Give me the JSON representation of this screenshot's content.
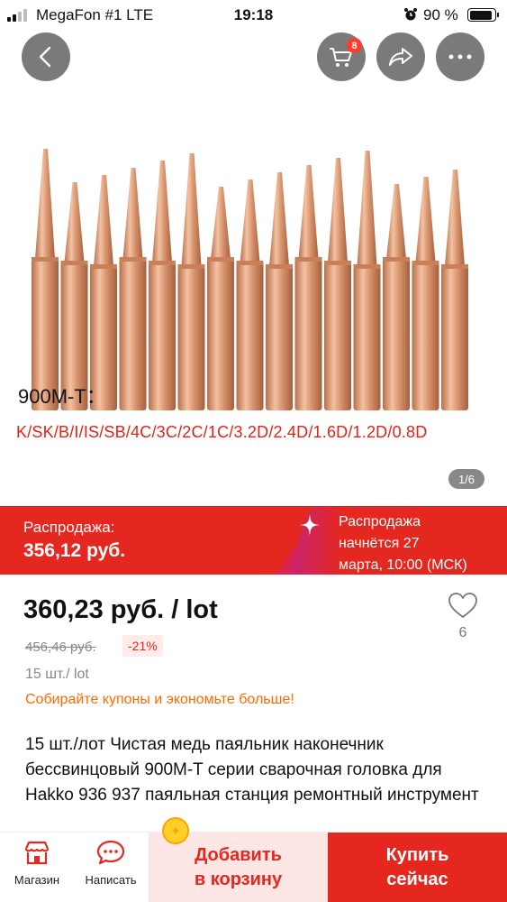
{
  "status_bar": {
    "carrier": "MegaFon #1  LTE",
    "time": "19:18",
    "battery_percent": "90 %",
    "battery_level": 0.9
  },
  "header": {
    "cart_badge": "8",
    "icons": [
      "back-arrow-icon",
      "cart-icon",
      "share-icon",
      "more-icon"
    ]
  },
  "gallery": {
    "model_line": "900M-T：",
    "tip_types": "K/SK/B/I/IS/SB/4C/3C/2C/1C/3.2D/2.4D/1.6D/1.2D/0.8D",
    "pager": "1/6",
    "tip_color": "#d99570",
    "tip_count": 15
  },
  "sale": {
    "label": "Распродажа:",
    "price": "356,12 руб.",
    "notice_line1": "Распродажа",
    "notice_line2": "начнётся 27",
    "notice_line3": "марта, 10:00 (МСК)"
  },
  "product": {
    "price": "360,23 руб. / lot",
    "old_price": "456,46 руб.",
    "discount": "-21%",
    "wishlist_count": "6",
    "quantity": "15 шт./ lot",
    "coupons": "Собирайте купоны и экономьте больше!",
    "title": "15 шт./лот Чистая медь паяльник наконечник бессвинцовый 900M-T серии сварочная головка для Hakko 936 937 паяльная станция ремонтный инструмент"
  },
  "bottom_bar": {
    "store_label": "Магазин",
    "chat_label": "Написать",
    "add_to_cart_line1": "Добавить",
    "add_to_cart_line2": "в корзину",
    "buy_now_line1": "Купить",
    "buy_now_line2": "сейчас"
  },
  "colors": {
    "accent": "#e4281f",
    "coupon": "#ff6a00"
  }
}
